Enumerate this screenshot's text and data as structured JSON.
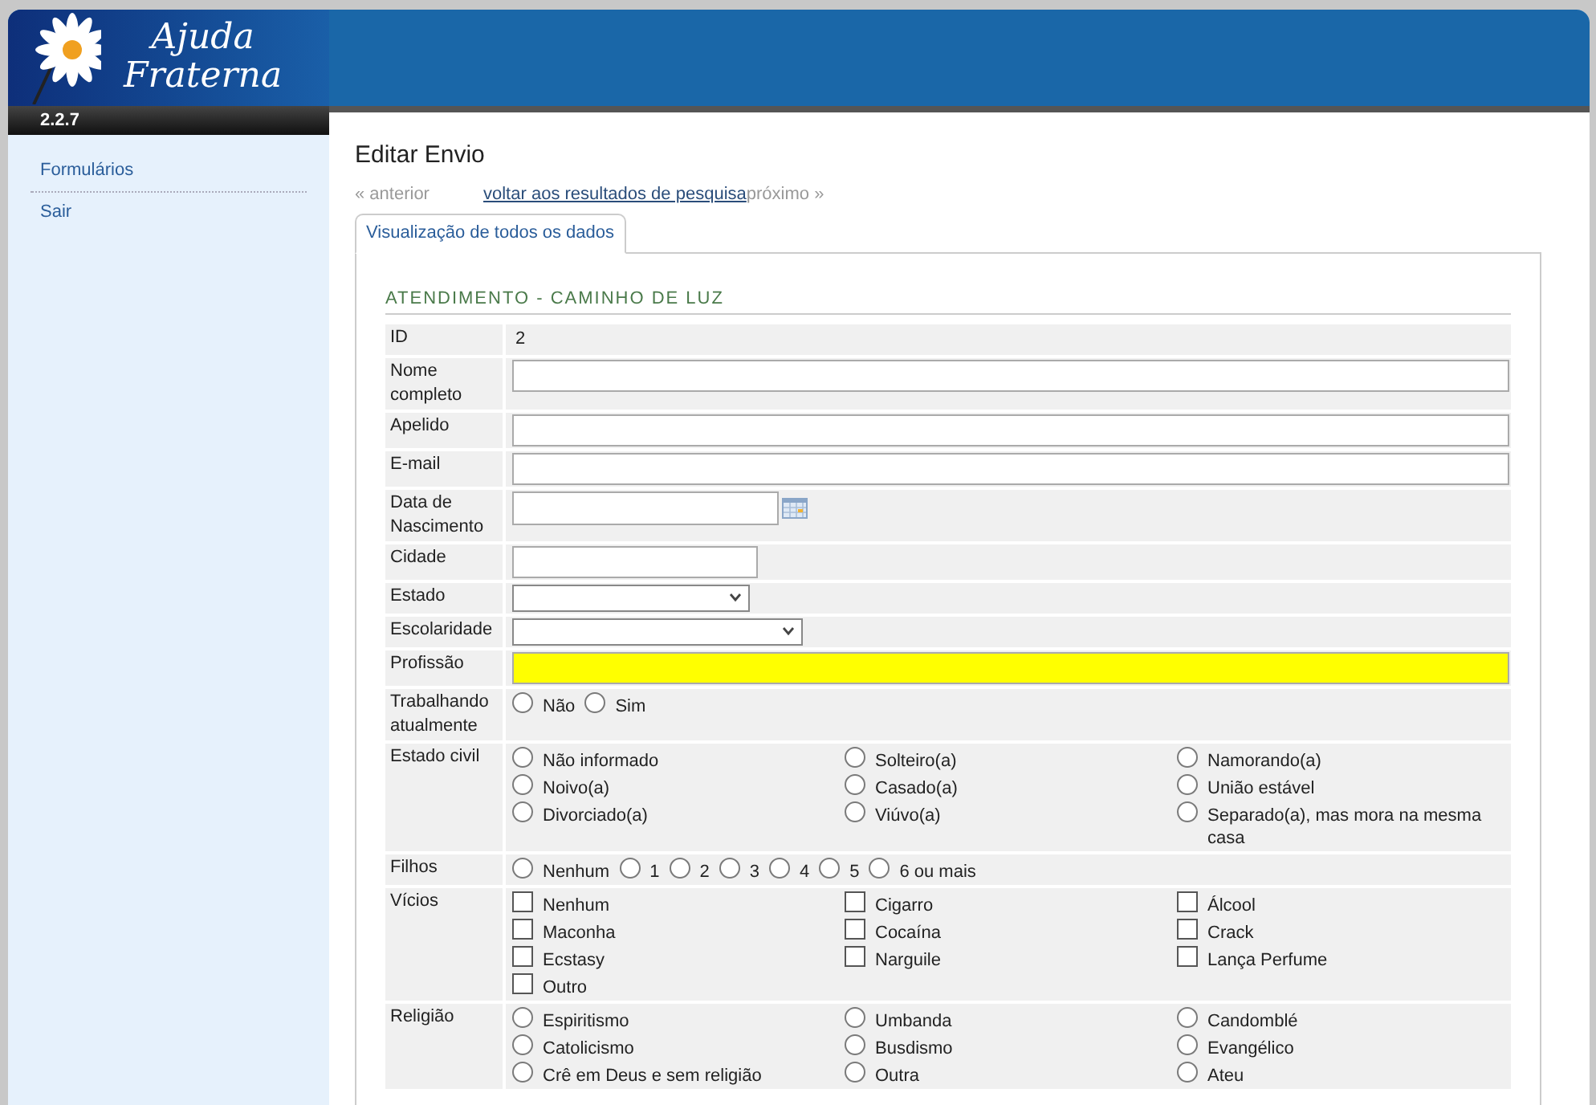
{
  "app": {
    "title_line1": "Ajuda",
    "title_line2": "Fraterna",
    "version": "2.2.7"
  },
  "sidebar": {
    "items": [
      {
        "label": "Formulários"
      },
      {
        "label": "Sair"
      }
    ]
  },
  "page": {
    "title": "Editar Envio",
    "nav_prev": "« anterior",
    "nav_back": "voltar aos resultados de pesquisa",
    "nav_next": "próximo »"
  },
  "tabs": [
    {
      "label": "Visualização de todos os dados",
      "selected": true
    }
  ],
  "form": {
    "section_title": "ATENDIMENTO - CAMINHO DE LUZ",
    "rows": [
      {
        "label": "ID",
        "kind": "static",
        "value": "2"
      },
      {
        "label": "Nome completo",
        "kind": "wideinput",
        "highlighted": false
      },
      {
        "label": "Apelido",
        "kind": "wideinput",
        "highlighted": false
      },
      {
        "label": "E-mail",
        "kind": "wideinput",
        "highlighted": false
      },
      {
        "label": "Data de Nascimento",
        "kind": "date"
      },
      {
        "label": "Cidade",
        "kind": "input",
        "highlighted": false
      },
      {
        "label": "Estado",
        "kind": "select"
      },
      {
        "label": "Escolaridade",
        "kind": "wideselect"
      },
      {
        "label": "Profissão",
        "kind": "wideinput",
        "highlighted": true
      },
      {
        "label": "Trabalhando atualmente",
        "kind": "radiorow",
        "options": [
          {
            "label": "Não",
            "selected": false
          },
          {
            "label": "Sim",
            "selected": false
          }
        ]
      },
      {
        "label": "Estado civil",
        "kind": "radiogrid",
        "options": [
          {
            "label": "Não informado",
            "selected": false
          },
          {
            "label": "Solteiro(a)",
            "selected": false
          },
          {
            "label": "Namorando(a)",
            "selected": false
          },
          {
            "label": "Noivo(a)",
            "selected": false
          },
          {
            "label": "Casado(a)",
            "selected": false
          },
          {
            "label": "União estável",
            "selected": false
          },
          {
            "label": "Divorciado(a)",
            "selected": false
          },
          {
            "label": "Viúvo(a)",
            "selected": false
          },
          {
            "label": "Separado(a), mas mora na mesma casa",
            "selected": false
          }
        ]
      },
      {
        "label": "Filhos",
        "kind": "radiorow",
        "options": [
          {
            "label": "Nenhum",
            "selected": false
          },
          {
            "label": "1",
            "selected": false
          },
          {
            "label": "2",
            "selected": false
          },
          {
            "label": "3",
            "selected": false
          },
          {
            "label": "4",
            "selected": false
          },
          {
            "label": "5",
            "selected": false
          },
          {
            "label": "6 ou mais",
            "selected": false
          }
        ]
      },
      {
        "label": "Vícios",
        "kind": "checkgrid",
        "options": [
          {
            "label": "Nenhum",
            "checked": false
          },
          {
            "label": "Cigarro",
            "checked": false
          },
          {
            "label": "Álcool",
            "checked": false
          },
          {
            "label": "Maconha",
            "checked": false
          },
          {
            "label": "Cocaína",
            "checked": false
          },
          {
            "label": "Crack",
            "checked": false
          },
          {
            "label": "Ecstasy",
            "checked": false
          },
          {
            "label": "Narguile",
            "checked": false
          },
          {
            "label": "Lança Perfume",
            "checked": false
          },
          {
            "label": "Outro",
            "checked": false
          }
        ]
      },
      {
        "label": "Religião",
        "kind": "radiogrid",
        "options": [
          {
            "label": "Espiritismo",
            "selected": false
          },
          {
            "label": "Umbanda",
            "selected": false
          },
          {
            "label": "Candomblé",
            "selected": false
          },
          {
            "label": "Catolicismo",
            "selected": false
          },
          {
            "label": "Busdismo",
            "selected": false
          },
          {
            "label": "Evangélico",
            "selected": false
          },
          {
            "label": "Crê em Deus e sem religião",
            "selected": false
          },
          {
            "label": "Outra",
            "selected": false
          },
          {
            "label": "Ateu",
            "selected": false
          }
        ]
      }
    ]
  }
}
